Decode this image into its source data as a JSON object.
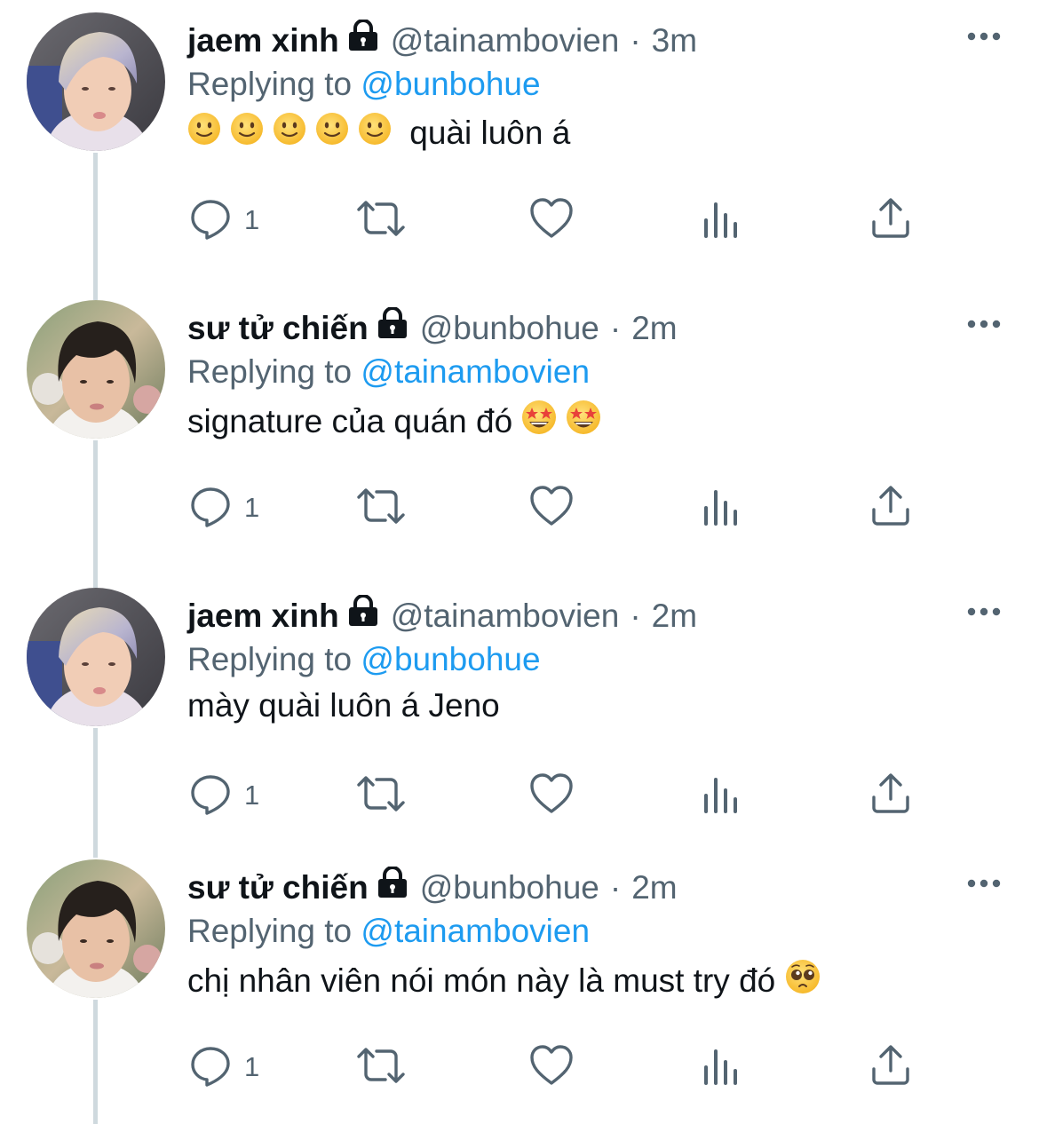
{
  "colors": {
    "primary_text": "#0f1419",
    "secondary_text": "#536471",
    "mention_blue": "#1d9bf0",
    "thread_line": "#cfd9de"
  },
  "tweets": [
    {
      "name": "jaem xinh",
      "handle": "@tainambovien",
      "separator": "·",
      "time": "3m",
      "replying_prefix": "Replying to",
      "replying_to": "@bunbohue",
      "emojis": [
        "slightly-smiling-face",
        "slightly-smiling-face",
        "slightly-smiling-face",
        "slightly-smiling-face",
        "slightly-smiling-face"
      ],
      "text": " quài luôn á",
      "reply_count": "1",
      "avatar": "avatar-blonde-hair"
    },
    {
      "name": "sư tử chiến",
      "handle": "@bunbohue",
      "separator": "·",
      "time": "2m",
      "replying_prefix": "Replying to",
      "replying_to": "@tainambovien",
      "text": "signature của quán đó ",
      "emojis_after": [
        "star-struck",
        "star-struck"
      ],
      "reply_count": "1",
      "avatar": "avatar-dark-hair"
    },
    {
      "name": "jaem xinh",
      "handle": "@tainambovien",
      "separator": "·",
      "time": "2m",
      "replying_prefix": "Replying to",
      "replying_to": "@bunbohue",
      "text": "mày quài luôn á Jeno",
      "reply_count": "1",
      "avatar": "avatar-blonde-hair"
    },
    {
      "name": "sư tử chiến",
      "handle": "@bunbohue",
      "separator": "·",
      "time": "2m",
      "replying_prefix": "Replying to",
      "replying_to": "@tainambovien",
      "text": "chị nhân viên nói món này là must try đó ",
      "emojis_after": [
        "pleading-face"
      ],
      "reply_count": "1",
      "avatar": "avatar-dark-hair"
    }
  ],
  "icons": {
    "lock": "lock-icon",
    "more": "more-icon",
    "reply": "reply-icon",
    "retweet": "retweet-icon",
    "like": "like-icon",
    "views": "views-icon",
    "share": "share-icon"
  }
}
